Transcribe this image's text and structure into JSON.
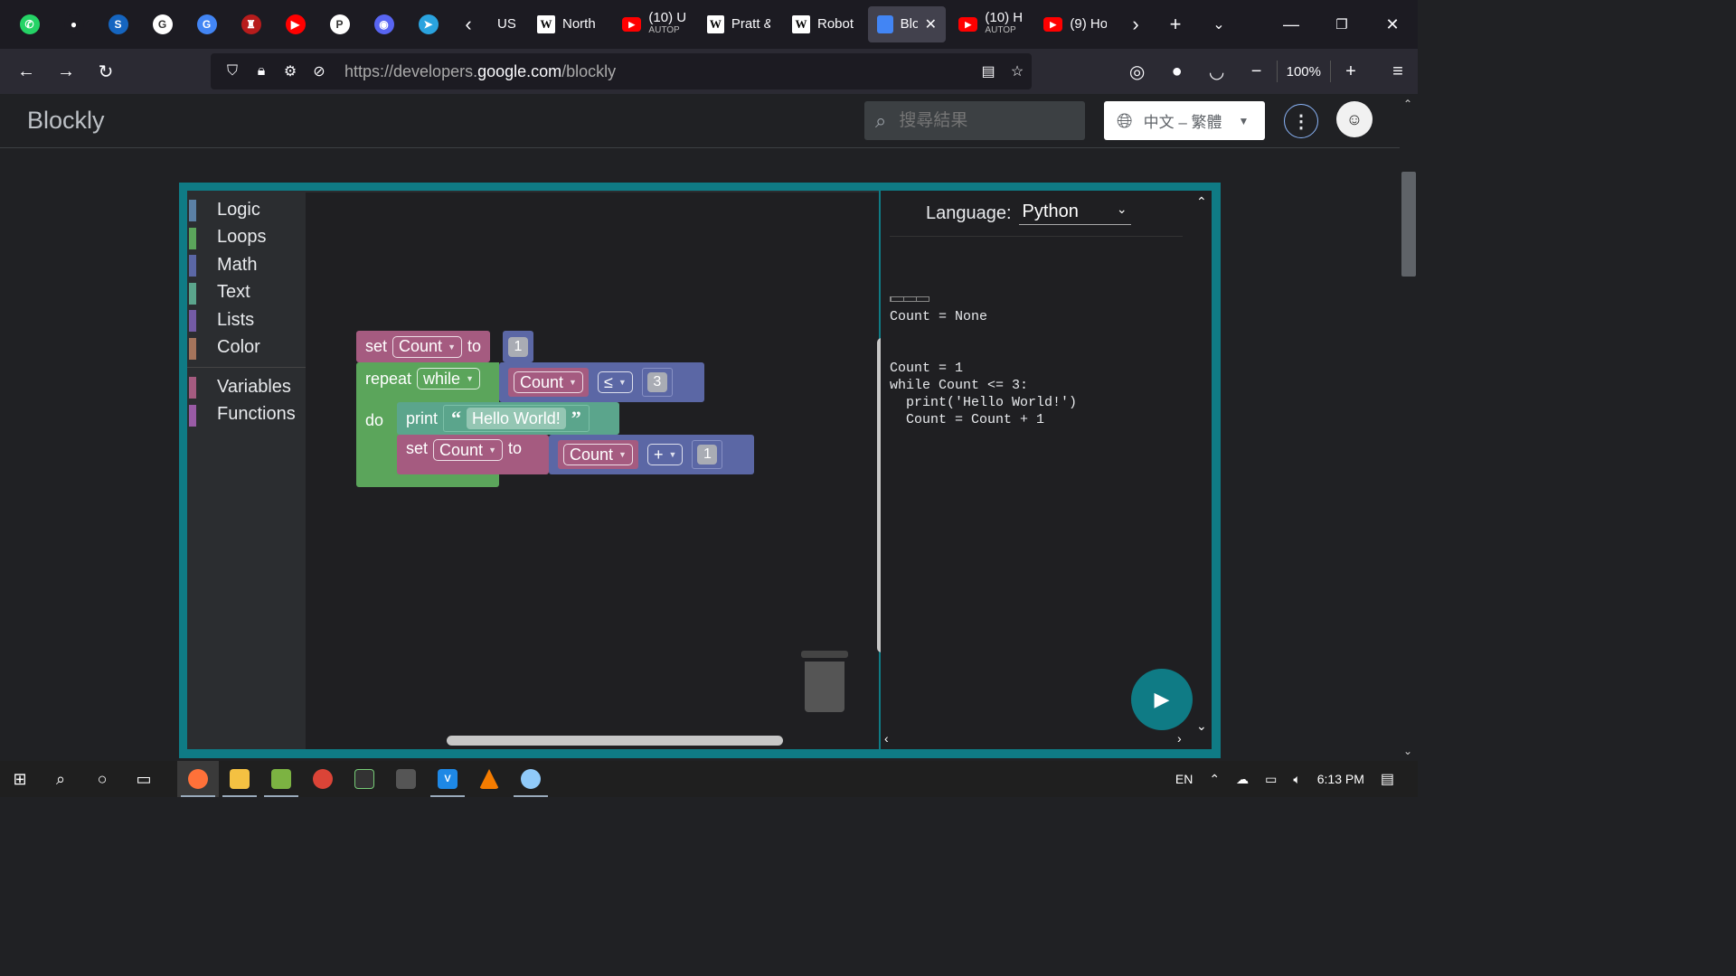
{
  "browser": {
    "pinned_tabs": [
      {
        "icon": "whatsapp-icon",
        "color": "#25d366",
        "glyph": "✆"
      },
      {
        "icon": "github-icon",
        "color": "#1c1b22",
        "glyph": "●"
      },
      {
        "icon": "steam-like-icon",
        "color": "#1565c0",
        "glyph": "S"
      },
      {
        "icon": "google-icon",
        "color": "#ffffff",
        "glyph": "G"
      },
      {
        "icon": "translate-icon",
        "color": "#4285f4",
        "glyph": "G"
      },
      {
        "icon": "crest-icon",
        "color": "#b71c1c",
        "glyph": "♜"
      },
      {
        "icon": "youtube-icon",
        "color": "#ff0000",
        "glyph": "▶"
      },
      {
        "icon": "patreon-icon",
        "color": "#ffffff",
        "glyph": "P"
      },
      {
        "icon": "discord-icon",
        "color": "#5865f2",
        "glyph": "◉"
      },
      {
        "icon": "telegram-icon",
        "color": "#2aa3df",
        "glyph": "➤"
      }
    ],
    "tabs": [
      {
        "type": "plain",
        "title": "US"
      },
      {
        "type": "wiki",
        "title": "North"
      },
      {
        "type": "yt",
        "title": "(10) U",
        "sub": "AUTOP"
      },
      {
        "type": "wiki",
        "title": "Pratt &"
      },
      {
        "type": "wiki",
        "title": "Robot"
      },
      {
        "type": "blockly",
        "title": "Blo",
        "active": true
      },
      {
        "type": "yt",
        "title": "(10) H",
        "sub": "AUTOP"
      },
      {
        "type": "yt",
        "title": "(9) Ho"
      }
    ],
    "url_prefix": "https://developers.",
    "url_domain": "google.com",
    "url_path": "/blockly",
    "zoom": "100%"
  },
  "page": {
    "logo": "Blockly",
    "search_placeholder": "搜尋結果",
    "language": "中文 – 繁體"
  },
  "toolbox": {
    "categories": [
      {
        "label": "Logic",
        "color": "#5b80a5"
      },
      {
        "label": "Loops",
        "color": "#5ba55b"
      },
      {
        "label": "Math",
        "color": "#5b67a5"
      },
      {
        "label": "Text",
        "color": "#5ba58c"
      },
      {
        "label": "Lists",
        "color": "#745ba5"
      },
      {
        "label": "Color",
        "color": "#a5745b"
      }
    ],
    "extra": [
      {
        "label": "Variables",
        "color": "#a55b80"
      },
      {
        "label": "Functions",
        "color": "#995ba5"
      }
    ]
  },
  "blocks": {
    "set1": {
      "kw": "set",
      "var": "Count",
      "to": "to",
      "val": "1"
    },
    "repeat": {
      "kw": "repeat",
      "mode": "while",
      "do": "do"
    },
    "compare": {
      "var": "Count",
      "op": "≤",
      "val": "3"
    },
    "print": {
      "kw": "print",
      "text": "Hello World!"
    },
    "set2": {
      "kw": "set",
      "var": "Count",
      "to": "to"
    },
    "arith": {
      "var": "Count",
      "op": "+",
      "val": "1"
    }
  },
  "code_panel": {
    "language_label": "Language:",
    "language": "Python",
    "code": "Count = None\n\n\nCount = 1\nwhile Count <= 3:\n  print('Hello World!')\n  Count = Count + 1"
  },
  "taskbar": {
    "lang": "EN",
    "time": "6:13 PM"
  }
}
